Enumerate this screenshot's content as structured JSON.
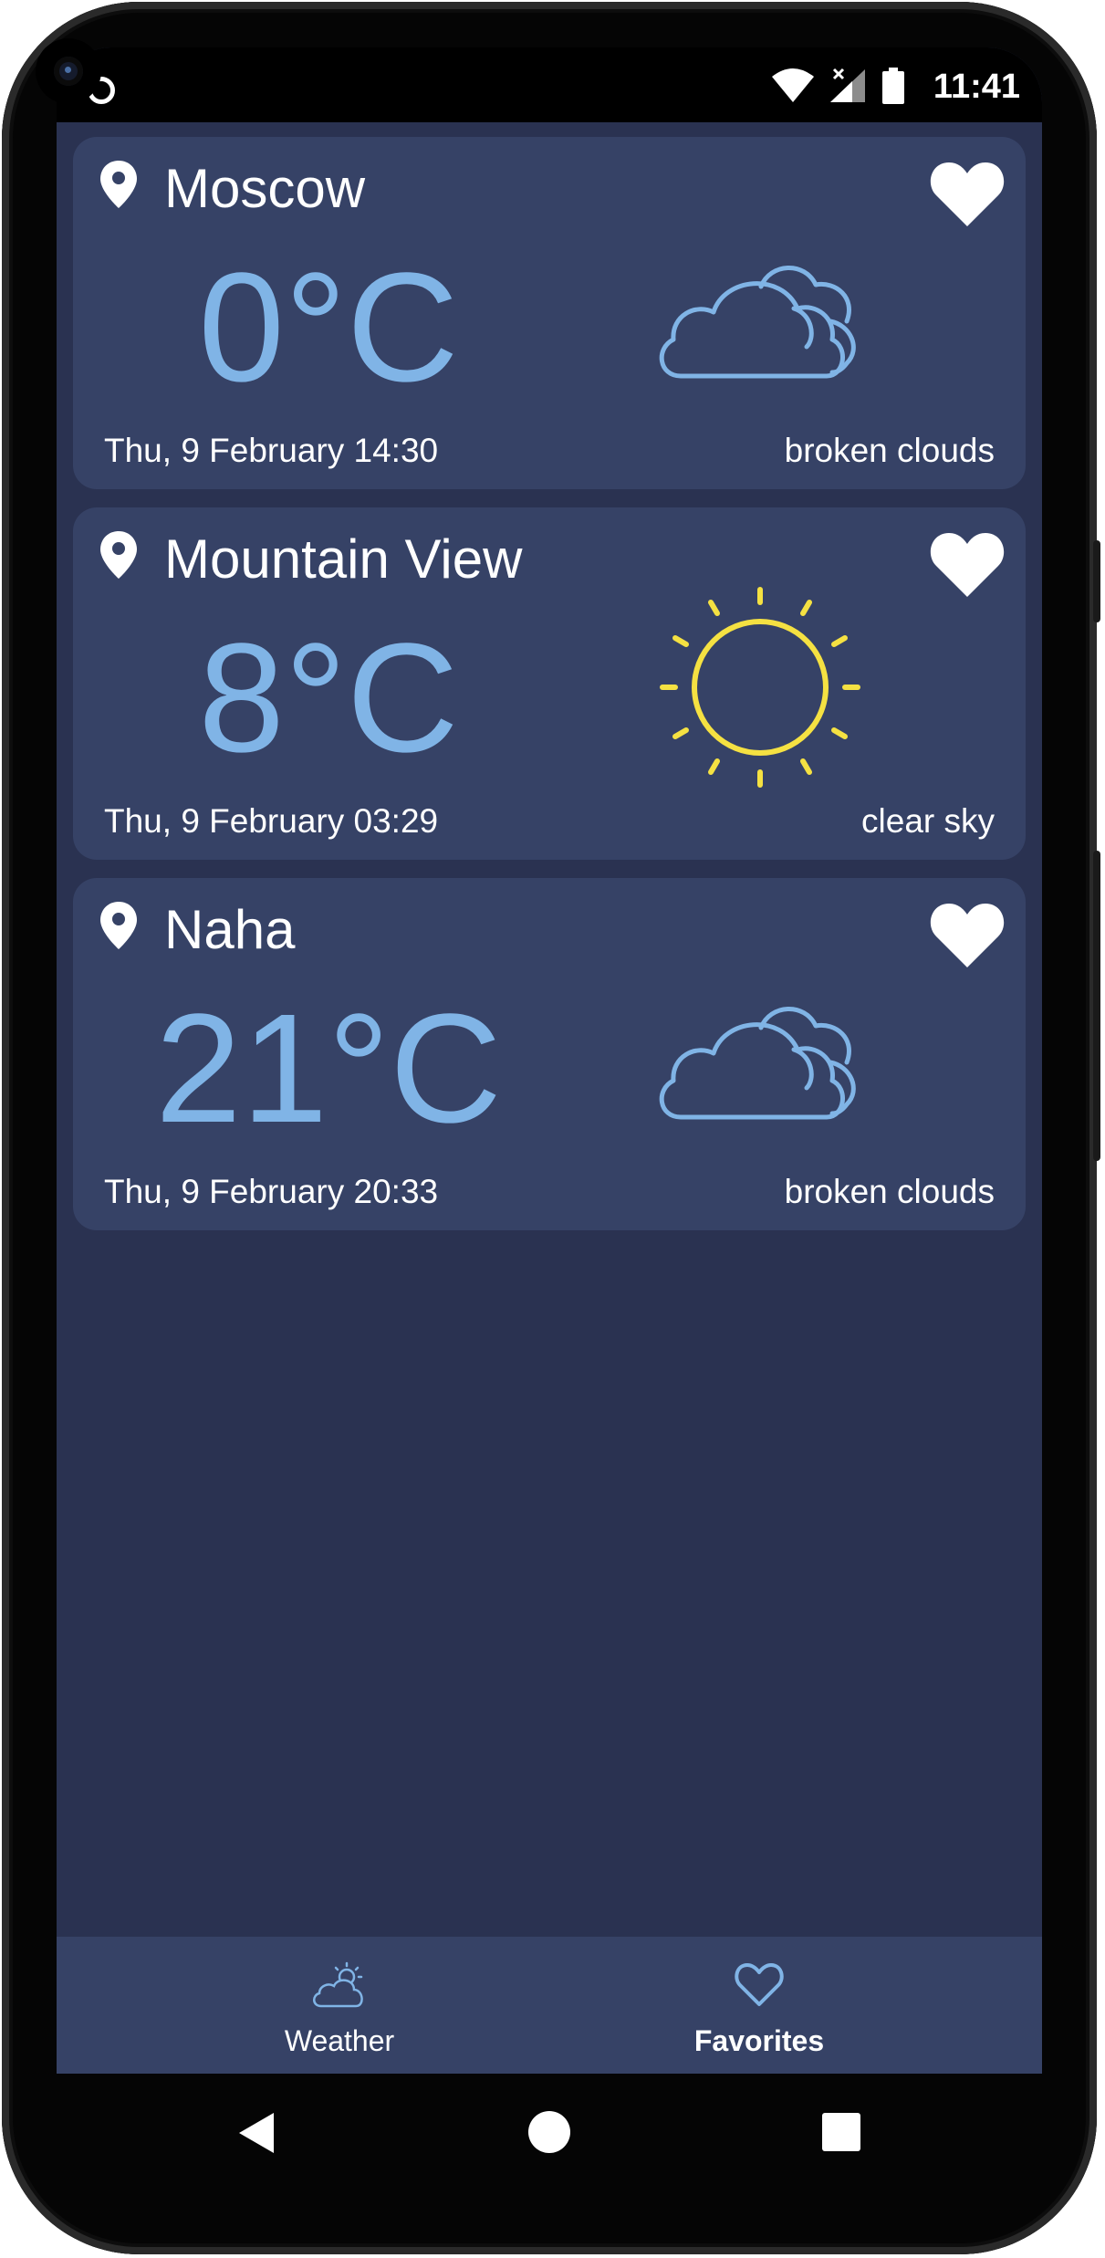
{
  "status_bar": {
    "time": "11:41",
    "icons": [
      "wifi-icon",
      "signal-icon",
      "battery-icon"
    ]
  },
  "cards": [
    {
      "city": "Moscow",
      "temperature": "0°C",
      "date": "Thu, 9 February 14:30",
      "description": "broken clouds",
      "weather_icon": "cloud-icon",
      "favorite": true
    },
    {
      "city": "Mountain View",
      "temperature": "8°C",
      "date": "Thu, 9 February 03:29",
      "description": "clear sky",
      "weather_icon": "sun-icon",
      "favorite": true
    },
    {
      "city": "Naha",
      "temperature": "21°C",
      "date": "Thu, 9 February 20:33",
      "description": "broken clouds",
      "weather_icon": "cloud-icon",
      "favorite": true
    }
  ],
  "bottom_nav": {
    "items": [
      {
        "label": "Weather",
        "icon": "partly-cloudy-icon",
        "active": false
      },
      {
        "label": "Favorites",
        "icon": "heart-outline-icon",
        "active": true
      }
    ]
  },
  "colors": {
    "background": "#2a3251",
    "card": "#364266",
    "temperature": "#80b4e6",
    "sun": "#f5e142",
    "text": "#ffffff"
  }
}
